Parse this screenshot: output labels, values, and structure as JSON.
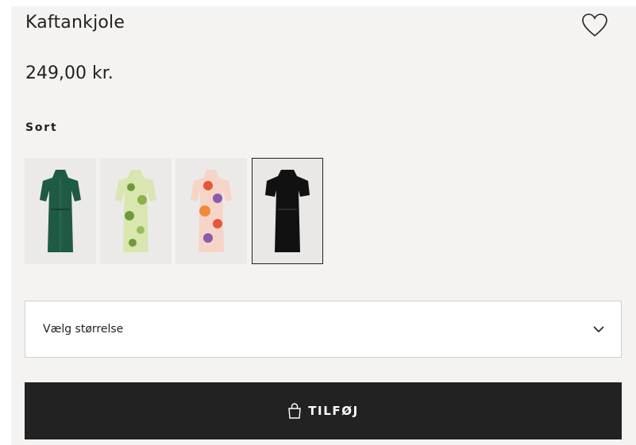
{
  "product": {
    "name": "Kaftankjole",
    "price": "249,00 kr.",
    "selected_color": "Sort"
  },
  "swatches": [
    {
      "color": "#1f5a45",
      "accent": "#2f7a5d"
    },
    {
      "color": "#c9d9a0",
      "accent": "#6f9a3a"
    },
    {
      "color": "#f2b7a6",
      "accent": "#e2593a"
    },
    {
      "color": "#111111",
      "accent": "#2a2a2a"
    }
  ],
  "size_select": {
    "placeholder": "Vælg størrelse"
  },
  "add_button": {
    "label": "TILFØJ"
  }
}
